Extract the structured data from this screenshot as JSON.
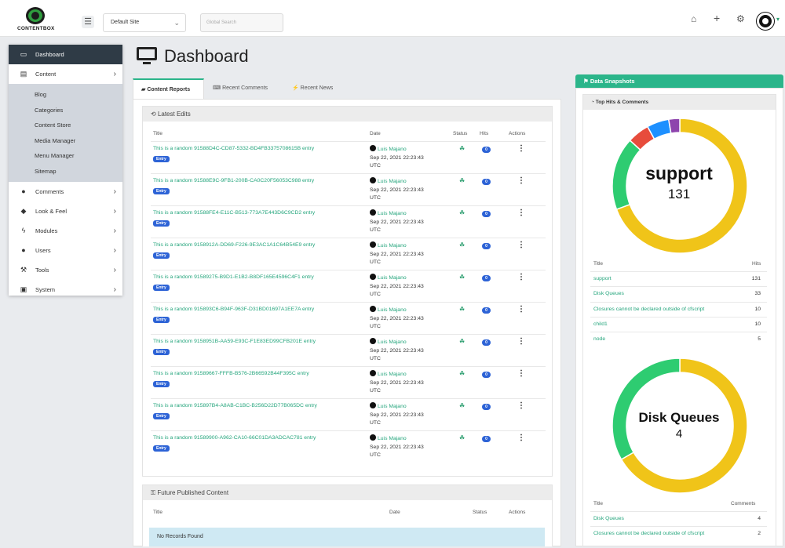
{
  "app": {
    "logo_text": "CONTENTBOX",
    "site_selector": "Default Site",
    "search_placeholder": "Global Search"
  },
  "sidebar": {
    "items": [
      {
        "label": "Dashboard",
        "icon": "monitor-icon"
      },
      {
        "label": "Content",
        "icon": "content-icon"
      },
      {
        "label": "Comments",
        "icon": "comment-icon"
      },
      {
        "label": "Look & Feel",
        "icon": "droplet-icon"
      },
      {
        "label": "Modules",
        "icon": "bolt-icon"
      },
      {
        "label": "Users",
        "icon": "user-icon"
      },
      {
        "label": "Tools",
        "icon": "wrench-icon"
      },
      {
        "label": "System",
        "icon": "briefcase-icon"
      }
    ],
    "content_sub": [
      "Blog",
      "Categories",
      "Content Store",
      "Media Manager",
      "Menu Manager",
      "Sitemap"
    ]
  },
  "page": {
    "title": "Dashboard"
  },
  "tabs": [
    "Content Reports",
    "Recent Comments",
    "Recent News"
  ],
  "latest_edits": {
    "title": "Latest Edits",
    "columns": [
      "Title",
      "Date",
      "Status",
      "Hits",
      "Actions"
    ],
    "badge": "Entry",
    "rows": [
      {
        "title": "This is a random 91588D4C-CD87-5332-BD4FB3375708615B entry",
        "author": "Luis Majano",
        "date1": "Sep 22, 2021 22:23:43",
        "date2": "UTC",
        "hits": "0"
      },
      {
        "title": "This is a random 91588E9C-9FB1-200B-CA0C20F56053C988 entry",
        "author": "Luis Majano",
        "date1": "Sep 22, 2021 22:23:43",
        "date2": "UTC",
        "hits": "0"
      },
      {
        "title": "This is a random 91588FE4-E11C-B513-773A7E443D6C9CD2 entry",
        "author": "Luis Majano",
        "date1": "Sep 22, 2021 22:23:43",
        "date2": "UTC",
        "hits": "0"
      },
      {
        "title": "This is a random 9158912A-DD69-F226-9E3AC1A1C64B54E9 entry",
        "author": "Luis Majano",
        "date1": "Sep 22, 2021 22:23:43",
        "date2": "UTC",
        "hits": "0"
      },
      {
        "title": "This is a random 91589275-B9D1-E1B2-B8DF165E4596C4F1 entry",
        "author": "Luis Majano",
        "date1": "Sep 22, 2021 22:23:43",
        "date2": "UTC",
        "hits": "0"
      },
      {
        "title": "This is a random 915893C6-B94F-963F-D31BD01697A1EE7A entry",
        "author": "Luis Majano",
        "date1": "Sep 22, 2021 22:23:43",
        "date2": "UTC",
        "hits": "0"
      },
      {
        "title": "This is a random 9158951B-AA59-E93C-F1E83ED99CFB201E entry",
        "author": "Luis Majano",
        "date1": "Sep 22, 2021 22:23:43",
        "date2": "UTC",
        "hits": "0"
      },
      {
        "title": "This is a random 91589667-FFFB-B576-2B66592B44F395C entry",
        "author": "Luis Majano",
        "date1": "Sep 22, 2021 22:23:43",
        "date2": "UTC",
        "hits": "0"
      },
      {
        "title": "This is a random 915897B4-A8AB-C1BC-B256D22D77B065DC entry",
        "author": "Luis Majano",
        "date1": "Sep 22, 2021 22:23:43",
        "date2": "UTC",
        "hits": "0"
      },
      {
        "title": "This is a random 91589900-A962-CA10-66C01DA3ADCAC781 entry",
        "author": "Luis Majano",
        "date1": "Sep 22, 2021 22:23:43",
        "date2": "UTC",
        "hits": "0"
      }
    ]
  },
  "future_content": {
    "title": "Future Published Content",
    "columns": [
      "Title",
      "Date",
      "Status",
      "Actions"
    ],
    "empty": "No Records Found"
  },
  "snapshots": {
    "title": "Data Snapshots",
    "sub_title": "Top Hits & Comments",
    "donut1": {
      "label": "support",
      "value": "131",
      "segments": [
        {
          "name": "support",
          "value": 131,
          "color": "#f0c419"
        },
        {
          "name": "Disk Queues",
          "value": 33,
          "color": "#2ecc71"
        },
        {
          "name": "Closures cannot be declared outside of cfscript",
          "value": 10,
          "color": "#e74c3c"
        },
        {
          "name": "child1",
          "value": 10,
          "color": "#1e90ff"
        },
        {
          "name": "node",
          "value": 5,
          "color": "#8e44ad"
        }
      ]
    },
    "hits_table": {
      "cols": [
        "Title",
        "Hits"
      ],
      "rows": [
        {
          "title": "support",
          "value": "131"
        },
        {
          "title": "Disk Queues",
          "value": "33"
        },
        {
          "title": "Closures cannot be declared outside of cfscript",
          "value": "10"
        },
        {
          "title": "child1",
          "value": "10"
        },
        {
          "title": "node",
          "value": "5"
        }
      ]
    },
    "donut2": {
      "label": "Disk Queues",
      "value": "4",
      "segments": [
        {
          "name": "Disk Queues",
          "value": 4,
          "color": "#f0c419"
        },
        {
          "name": "Closures cannot be declared outside of cfscript",
          "value": 2,
          "color": "#2ecc71"
        }
      ]
    },
    "comments_table": {
      "cols": [
        "Title",
        "Comments"
      ],
      "rows": [
        {
          "title": "Disk Queues",
          "value": "4"
        },
        {
          "title": "Closures cannot be declared outside of cfscript",
          "value": "2"
        }
      ]
    }
  }
}
